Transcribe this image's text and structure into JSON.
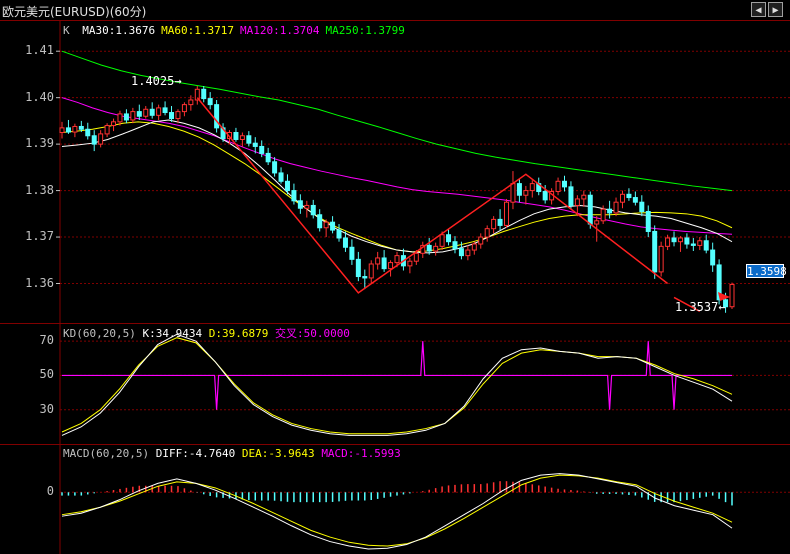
{
  "window": {
    "title": "欧元美元(EURUSD)(60分)",
    "nav_left_icon": "arrow-left-icon",
    "nav_right_icon": "arrow-right-icon"
  },
  "main_panel": {
    "legend_prefix": "K",
    "ma_labels": [
      {
        "text": "MA30:1.3676",
        "color": "#ffffff"
      },
      {
        "text": "MA60:1.3717",
        "color": "#ffff00"
      },
      {
        "text": "MA120:1.3704",
        "color": "#ff00ff"
      },
      {
        "text": "MA250:1.3799",
        "color": "#00ff00"
      }
    ],
    "y_labels": [
      "1.41",
      "1.40",
      "1.39",
      "1.38",
      "1.37",
      "1.36"
    ],
    "high_annotation": "1.4025",
    "low_annotation": "1.3537",
    "current_price": "1.3598"
  },
  "kd_panel": {
    "title": "KD(60,20,5)",
    "k_label": "K:34.9434",
    "d_label": "D:39.6879",
    "cross_label": "交叉:50.0000",
    "y_labels": [
      "70",
      "50",
      "30"
    ]
  },
  "macd_panel": {
    "title": "MACD(60,20,5)",
    "diff_label": "DIFF:-4.7640",
    "dea_label": "DEA:-3.9643",
    "macd_label": "MACD:-1.5993",
    "y_labels": [
      "0"
    ]
  },
  "colors": {
    "up": "#ff3232",
    "down": "#54ffff",
    "ma30": "#ffffff",
    "ma60": "#ffff00",
    "ma120": "#ff00ff",
    "ma250": "#00ff00",
    "grid": "#800000",
    "trend": "#ff2020",
    "cross": "#ff00ff"
  },
  "chart_data": {
    "type": "candlestick",
    "symbol": "EURUSD",
    "interval": "60分",
    "price_ylim": [
      1.3515,
      1.4165
    ],
    "price_ticks": [
      1.41,
      1.4,
      1.39,
      1.38,
      1.37,
      1.36
    ],
    "candles": [
      [
        1.3925,
        1.3948,
        1.3912,
        1.3935
      ],
      [
        1.3935,
        1.3952,
        1.3922,
        1.3926
      ],
      [
        1.3926,
        1.3944,
        1.3915,
        1.3938
      ],
      [
        1.3938,
        1.395,
        1.3926,
        1.3932
      ],
      [
        1.3932,
        1.3946,
        1.391,
        1.3918
      ],
      [
        1.3918,
        1.393,
        1.3885,
        1.39
      ],
      [
        1.39,
        1.393,
        1.3893,
        1.3922
      ],
      [
        1.3922,
        1.3945,
        1.3915,
        1.394
      ],
      [
        1.394,
        1.3955,
        1.3928,
        1.3948
      ],
      [
        1.3948,
        1.3972,
        1.394,
        1.3965
      ],
      [
        1.3965,
        1.3975,
        1.3945,
        1.3952
      ],
      [
        1.3952,
        1.3978,
        1.3945,
        1.397
      ],
      [
        1.397,
        1.3985,
        1.3952,
        1.396
      ],
      [
        1.396,
        1.3982,
        1.3955,
        1.3975
      ],
      [
        1.3975,
        1.399,
        1.3955,
        1.3962
      ],
      [
        1.3962,
        1.3985,
        1.3952,
        1.3978
      ],
      [
        1.3978,
        1.3992,
        1.3962,
        1.3968
      ],
      [
        1.3968,
        1.3982,
        1.3948,
        1.3955
      ],
      [
        1.3955,
        1.3975,
        1.3945,
        1.397
      ],
      [
        1.397,
        1.399,
        1.396,
        1.3985
      ],
      [
        1.3985,
        1.4005,
        1.3972,
        1.3995
      ],
      [
        1.3995,
        1.4025,
        1.3985,
        1.4018
      ],
      [
        1.4018,
        1.4025,
        1.399,
        1.3998
      ],
      [
        1.3998,
        1.4012,
        1.3975,
        1.3985
      ],
      [
        1.3985,
        1.3995,
        1.3925,
        1.3935
      ],
      [
        1.3935,
        1.3945,
        1.3905,
        1.3912
      ],
      [
        1.3912,
        1.393,
        1.39,
        1.3925
      ],
      [
        1.3925,
        1.3935,
        1.3905,
        1.391
      ],
      [
        1.391,
        1.3925,
        1.3895,
        1.3918
      ],
      [
        1.3918,
        1.3928,
        1.3895,
        1.3902
      ],
      [
        1.3902,
        1.3915,
        1.388,
        1.3895
      ],
      [
        1.3895,
        1.3908,
        1.3872,
        1.388
      ],
      [
        1.388,
        1.3892,
        1.3855,
        1.3862
      ],
      [
        1.3862,
        1.3872,
        1.383,
        1.3838
      ],
      [
        1.3838,
        1.385,
        1.3815,
        1.382
      ],
      [
        1.382,
        1.3835,
        1.3792,
        1.38
      ],
      [
        1.38,
        1.3815,
        1.377,
        1.3778
      ],
      [
        1.3778,
        1.3792,
        1.375,
        1.3762
      ],
      [
        1.3762,
        1.3778,
        1.3742,
        1.3768
      ],
      [
        1.3768,
        1.378,
        1.374,
        1.3748
      ],
      [
        1.3748,
        1.376,
        1.3712,
        1.372
      ],
      [
        1.372,
        1.3738,
        1.37,
        1.3732
      ],
      [
        1.3732,
        1.3745,
        1.3708,
        1.3715
      ],
      [
        1.3715,
        1.3728,
        1.369,
        1.3698
      ],
      [
        1.3698,
        1.3712,
        1.3668,
        1.3678
      ],
      [
        1.3678,
        1.3695,
        1.364,
        1.3652
      ],
      [
        1.3652,
        1.3668,
        1.3605,
        1.3615
      ],
      [
        1.3615,
        1.363,
        1.3588,
        1.3612
      ],
      [
        1.3612,
        1.365,
        1.36,
        1.3642
      ],
      [
        1.3642,
        1.3668,
        1.363,
        1.3655
      ],
      [
        1.3655,
        1.3672,
        1.3625,
        1.3632
      ],
      [
        1.3632,
        1.365,
        1.3615,
        1.3645
      ],
      [
        1.3645,
        1.3668,
        1.3635,
        1.366
      ],
      [
        1.366,
        1.3675,
        1.3628,
        1.3638
      ],
      [
        1.3638,
        1.3655,
        1.3622,
        1.3648
      ],
      [
        1.3648,
        1.3672,
        1.364,
        1.3665
      ],
      [
        1.3665,
        1.369,
        1.3655,
        1.3682
      ],
      [
        1.3682,
        1.3698,
        1.3662,
        1.367
      ],
      [
        1.367,
        1.3688,
        1.366,
        1.368
      ],
      [
        1.368,
        1.3712,
        1.3672,
        1.3705
      ],
      [
        1.3705,
        1.3718,
        1.3682,
        1.369
      ],
      [
        1.369,
        1.3702,
        1.3665,
        1.3675
      ],
      [
        1.3675,
        1.369,
        1.3652,
        1.366
      ],
      [
        1.366,
        1.3682,
        1.365,
        1.3672
      ],
      [
        1.3672,
        1.369,
        1.3662,
        1.3685
      ],
      [
        1.3685,
        1.3708,
        1.3675,
        1.37
      ],
      [
        1.37,
        1.3725,
        1.369,
        1.3718
      ],
      [
        1.3718,
        1.3745,
        1.3708,
        1.3738
      ],
      [
        1.3738,
        1.376,
        1.3715,
        1.3725
      ],
      [
        1.3725,
        1.3782,
        1.372,
        1.3775
      ],
      [
        1.3775,
        1.3842,
        1.376,
        1.3815
      ],
      [
        1.3815,
        1.3825,
        1.3775,
        1.379
      ],
      [
        1.379,
        1.381,
        1.377,
        1.38
      ],
      [
        1.38,
        1.3822,
        1.3785,
        1.3815
      ],
      [
        1.3815,
        1.3828,
        1.379,
        1.3798
      ],
      [
        1.3798,
        1.3812,
        1.3772,
        1.378
      ],
      [
        1.378,
        1.3805,
        1.377,
        1.3798
      ],
      [
        1.3798,
        1.3828,
        1.379,
        1.382
      ],
      [
        1.382,
        1.3832,
        1.3798,
        1.3808
      ],
      [
        1.3808,
        1.382,
        1.376,
        1.3768
      ],
      [
        1.3768,
        1.379,
        1.3745,
        1.3782
      ],
      [
        1.3782,
        1.38,
        1.3765,
        1.379
      ],
      [
        1.379,
        1.3798,
        1.3718,
        1.3728
      ],
      [
        1.3728,
        1.3745,
        1.369,
        1.3735
      ],
      [
        1.3735,
        1.3768,
        1.3728,
        1.376
      ],
      [
        1.376,
        1.3778,
        1.374,
        1.3752
      ],
      [
        1.3752,
        1.3785,
        1.3745,
        1.3775
      ],
      [
        1.3775,
        1.38,
        1.3762,
        1.3792
      ],
      [
        1.3792,
        1.3805,
        1.3778,
        1.3785
      ],
      [
        1.3785,
        1.3798,
        1.3768,
        1.3775
      ],
      [
        1.3775,
        1.379,
        1.3745,
        1.3755
      ],
      [
        1.3755,
        1.3768,
        1.37,
        1.3712
      ],
      [
        1.3712,
        1.3725,
        1.361,
        1.3625
      ],
      [
        1.3625,
        1.369,
        1.3615,
        1.368
      ],
      [
        1.368,
        1.3705,
        1.3672,
        1.3698
      ],
      [
        1.3698,
        1.3712,
        1.368,
        1.369
      ],
      [
        1.369,
        1.3702,
        1.3668,
        1.3698
      ],
      [
        1.3698,
        1.3708,
        1.3675,
        1.3685
      ],
      [
        1.3685,
        1.3698,
        1.367,
        1.3682
      ],
      [
        1.3682,
        1.37,
        1.3672,
        1.3692
      ],
      [
        1.3692,
        1.3705,
        1.3665,
        1.3672
      ],
      [
        1.3672,
        1.3688,
        1.3625,
        1.364
      ],
      [
        1.364,
        1.3652,
        1.3555,
        1.3565
      ],
      [
        1.3565,
        1.358,
        1.3537,
        1.355
      ],
      [
        1.355,
        1.3602,
        1.3545,
        1.3598
      ]
    ],
    "ma30": [
      1.3895,
      1.3898,
      1.3902,
      1.391,
      1.3922,
      1.3935,
      1.3948,
      1.3952,
      1.3945,
      1.3935,
      1.392,
      1.3902,
      1.388,
      1.3852,
      1.3822,
      1.379,
      1.3762,
      1.3738,
      1.3718,
      1.3702,
      1.369,
      1.368,
      1.3672,
      1.3668,
      1.3666,
      1.3668,
      1.3675,
      1.3685,
      1.37,
      1.3718,
      1.3735,
      1.375,
      1.376,
      1.3765,
      1.3768,
      1.3765,
      1.3758,
      1.3752,
      1.3748,
      1.3745,
      1.374,
      1.373,
      1.372,
      1.3708,
      1.369
    ],
    "ma60": [
      1.3925,
      1.3928,
      1.3932,
      1.3938,
      1.3945,
      1.3948,
      1.3945,
      1.3938,
      1.3928,
      1.3915,
      1.3898,
      1.3878,
      1.3858,
      1.3835,
      1.381,
      1.3785,
      1.3762,
      1.374,
      1.3722,
      1.3708,
      1.3695,
      1.3682,
      1.3672,
      1.3668,
      1.367,
      1.3675,
      1.3682,
      1.369,
      1.37,
      1.3712,
      1.3722,
      1.3732,
      1.374,
      1.3745,
      1.3748,
      1.3748,
      1.3748,
      1.375,
      1.3752,
      1.3753,
      1.3752,
      1.375,
      1.3745,
      1.3735,
      1.372
    ],
    "ma120": [
      1.4,
      1.399,
      1.3978,
      1.3968,
      1.396,
      1.3955,
      1.395,
      1.3945,
      1.3938,
      1.3928,
      1.3918,
      1.3905,
      1.3892,
      1.388,
      1.3868,
      1.3858,
      1.385,
      1.3842,
      1.3835,
      1.3828,
      1.3822,
      1.3815,
      1.3808,
      1.3802,
      1.3798,
      1.3795,
      1.3792,
      1.3788,
      1.3784,
      1.378,
      1.3775,
      1.377,
      1.3765,
      1.3758,
      1.375,
      1.3742,
      1.3735,
      1.3728,
      1.3722,
      1.3718,
      1.3715,
      1.3712,
      1.371,
      1.3708,
      1.3706
    ],
    "ma250": [
      1.41,
      1.4085,
      1.407,
      1.4058,
      1.4048,
      1.404,
      1.4032,
      1.4025,
      1.4018,
      1.401,
      1.4002,
      1.3995,
      1.3985,
      1.3975,
      1.3962,
      1.395,
      1.3938,
      1.3925,
      1.3912,
      1.39,
      1.389,
      1.388,
      1.3872,
      1.3865,
      1.3858,
      1.3852,
      1.3846,
      1.384,
      1.3834,
      1.3828,
      1.3822,
      1.3816,
      1.381,
      1.3805,
      1.38
    ],
    "trend_lines": [
      [
        [
          21,
          1.4
        ],
        [
          46,
          1.358
        ],
        [
          72,
          1.3835
        ],
        [
          94,
          1.36
        ]
      ],
      [
        [
          95,
          1.357
        ],
        [
          99,
          1.354
        ]
      ]
    ],
    "kd": {
      "ylim": [
        10,
        80
      ],
      "k": [
        15,
        20,
        28,
        40,
        55,
        68,
        74,
        70,
        58,
        44,
        33,
        26,
        21,
        18,
        16,
        15,
        15,
        15,
        16,
        18,
        22,
        32,
        48,
        60,
        65,
        66,
        64,
        63,
        60,
        61,
        60,
        55,
        50,
        46,
        42,
        35
      ],
      "d": [
        17,
        22,
        30,
        42,
        56,
        67,
        72,
        69,
        58,
        45,
        34,
        27,
        22,
        19,
        17,
        16,
        16,
        16,
        17,
        19,
        22,
        31,
        45,
        57,
        63,
        65,
        64,
        63,
        61,
        61,
        60,
        56,
        51,
        48,
        44,
        39
      ],
      "cross_level": 50,
      "spikes": [
        [
          24,
          30
        ],
        [
          56,
          70
        ],
        [
          85,
          30
        ],
        [
          91,
          70
        ],
        [
          95,
          30
        ]
      ]
    },
    "macd": {
      "ylim": [
        -8,
        5
      ],
      "diff": [
        -3.2,
        -2.8,
        -2.0,
        -1.0,
        0.2,
        1.2,
        1.8,
        1.2,
        0.3,
        -0.8,
        -2.0,
        -3.2,
        -4.5,
        -5.7,
        -6.6,
        -7.2,
        -7.6,
        -7.5,
        -7.0,
        -6.0,
        -4.5,
        -3.0,
        -1.5,
        0.2,
        1.6,
        2.3,
        2.5,
        2.3,
        1.8,
        1.3,
        0.8,
        -0.8,
        -1.8,
        -2.4,
        -3.0,
        -4.8
      ],
      "dea": [
        -3.0,
        -2.6,
        -2.0,
        -1.2,
        -0.2,
        0.8,
        1.4,
        1.2,
        0.6,
        -0.4,
        -1.5,
        -2.7,
        -3.9,
        -5.1,
        -6.0,
        -6.7,
        -7.1,
        -7.2,
        -6.9,
        -6.1,
        -4.9,
        -3.5,
        -2.0,
        -0.5,
        1.0,
        1.9,
        2.3,
        2.2,
        1.9,
        1.4,
        1.0,
        -0.2,
        -1.2,
        -2.0,
        -2.8,
        -4.0
      ]
    }
  }
}
